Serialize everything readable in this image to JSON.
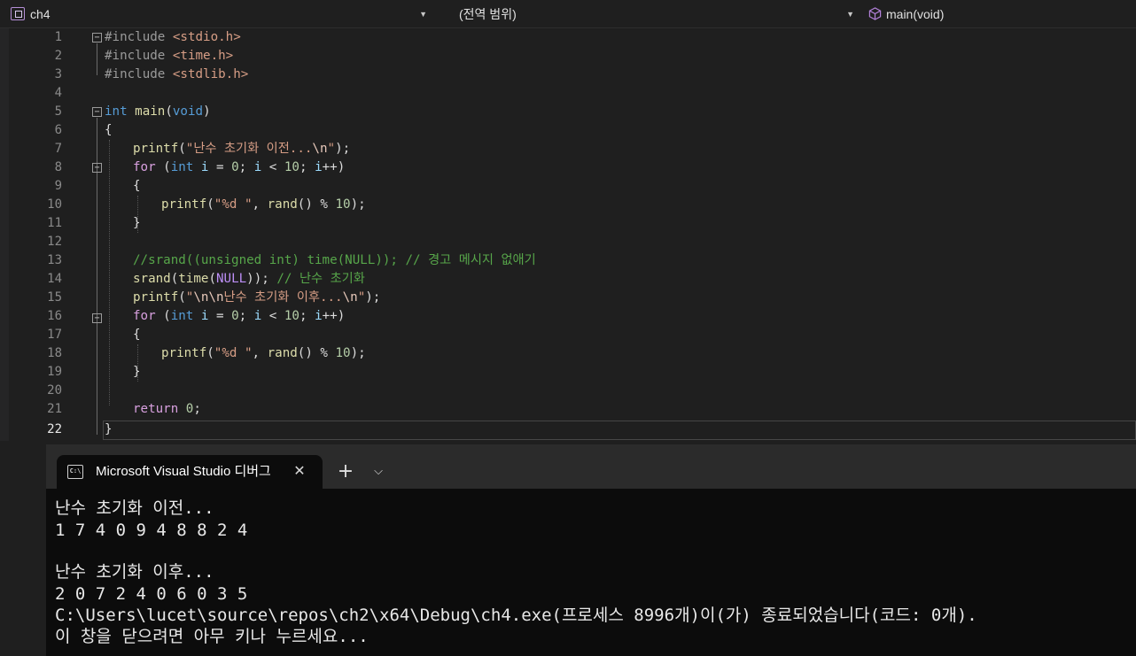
{
  "navbar": {
    "project": "ch4",
    "scope": "(전역 범위)",
    "member": "main(void)",
    "project_icon": "project-icon",
    "member_icon": "cube-icon"
  },
  "editor": {
    "line_numbers": [
      "1",
      "2",
      "3",
      "4",
      "5",
      "6",
      "7",
      "8",
      "9",
      "10",
      "11",
      "12",
      "13",
      "14",
      "15",
      "16",
      "17",
      "18",
      "19",
      "20",
      "21",
      "22"
    ],
    "current_line": "22"
  },
  "code": {
    "l1": {
      "a": "#include ",
      "b": "<stdio.h>"
    },
    "l2": {
      "a": "#include ",
      "b": "<time.h>"
    },
    "l3": {
      "a": "#include ",
      "b": "<stdlib.h>"
    },
    "l5": {
      "a": "int",
      "b": " ",
      "c": "main",
      "d": "(",
      "e": "void",
      "f": ")"
    },
    "l6": "{",
    "l7": {
      "a": "printf",
      "b": "(",
      "c": "\"난수 초기화 이전...",
      "d": "\\n",
      "e": "\"",
      "f": ");"
    },
    "l8": {
      "a": "for",
      "b": " (",
      "c": "int",
      "d": " ",
      "e": "i",
      "f": " = ",
      "g": "0",
      "h": "; ",
      "i": "i",
      "j": " < ",
      "k": "10",
      "l": "; ",
      "m": "i",
      "n": "++)"
    },
    "l9": "{",
    "l10": {
      "a": "printf",
      "b": "(",
      "c": "\"%d \"",
      "d": ", ",
      "e": "rand",
      "f": "() % ",
      "g": "10",
      "h": ");"
    },
    "l11": "}",
    "l13": "//srand((unsigned int) time(NULL)); // 경고 메시지 없애기",
    "l14": {
      "a": "srand",
      "b": "(",
      "c": "time",
      "d": "(",
      "e": "NULL",
      "f": ")); ",
      "g": "// 난수 초기화"
    },
    "l15": {
      "a": "printf",
      "b": "(",
      "c": "\"",
      "d": "\\n\\n",
      "e": "난수 초기화 이후...",
      "f": "\\n",
      "g": "\"",
      "h": ");"
    },
    "l16": {
      "a": "for",
      "b": " (",
      "c": "int",
      "d": " ",
      "e": "i",
      "f": " = ",
      "g": "0",
      "h": "; ",
      "i": "i",
      "j": " < ",
      "k": "10",
      "l": "; ",
      "m": "i",
      "n": "++)"
    },
    "l17": "{",
    "l18": {
      "a": "printf",
      "b": "(",
      "c": "\"%d \"",
      "d": ", ",
      "e": "rand",
      "f": "() % ",
      "g": "10",
      "h": ");"
    },
    "l19": "}",
    "l21": {
      "a": "return",
      "b": " ",
      "c": "0",
      "d": ";"
    },
    "l22": "}"
  },
  "terminal": {
    "tab_title": "Microsoft Visual Studio 디버그",
    "tab_icon_text": "C:\\",
    "close_glyph": "✕",
    "new_tab_glyph": "+",
    "dropdown_glyph": "⌵",
    "lines": [
      "난수 초기화 이전...",
      "1 7 4 0 9 4 8 8 2 4",
      "",
      "난수 초기화 이후...",
      "2 0 7 2 4 0 6 0 3 5",
      "C:\\Users\\lucet\\source\\repos\\ch2\\x64\\Debug\\ch4.exe(프로세스 8996개)이(가) 종료되었습니다(코드: 0개).",
      "이 창을 닫으려면 아무 키나 누르세요..."
    ]
  }
}
